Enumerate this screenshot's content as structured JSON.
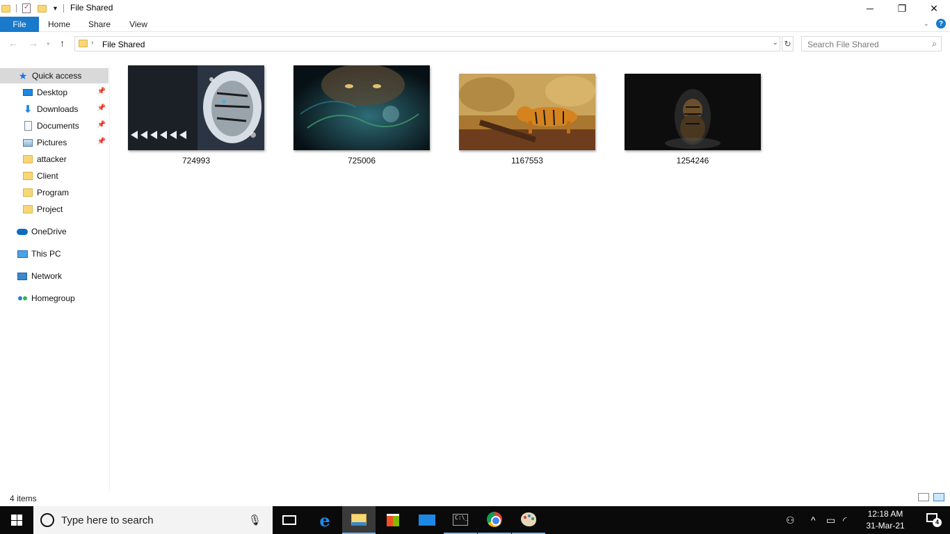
{
  "window": {
    "title": "File Shared"
  },
  "ribbon": {
    "tabs": [
      "File",
      "Home",
      "Share",
      "View"
    ]
  },
  "address": {
    "path": "File Shared"
  },
  "search": {
    "placeholder": "Search File Shared"
  },
  "sidebar": {
    "quick_access": "Quick access",
    "items": [
      {
        "label": "Desktop",
        "icon": "desktop-icon",
        "pinned": true
      },
      {
        "label": "Downloads",
        "icon": "download-icon",
        "pinned": true
      },
      {
        "label": "Documents",
        "icon": "documents-icon",
        "pinned": true
      },
      {
        "label": "Pictures",
        "icon": "pictures-icon",
        "pinned": true
      },
      {
        "label": "attacker",
        "icon": "folder-icon",
        "pinned": false
      },
      {
        "label": "Client",
        "icon": "folder-icon",
        "pinned": false
      },
      {
        "label": "Program",
        "icon": "folder-icon",
        "pinned": false
      },
      {
        "label": "Project",
        "icon": "folder-icon",
        "pinned": false
      }
    ],
    "locations": [
      "OneDrive",
      "This PC",
      "Network",
      "Homegroup"
    ]
  },
  "files": [
    {
      "name": "724993",
      "icon": "tiger-image-thumbnail"
    },
    {
      "name": "725006",
      "icon": "tiger-image-thumbnail"
    },
    {
      "name": "1167553",
      "icon": "tiger-image-thumbnail"
    },
    {
      "name": "1254246",
      "icon": "tiger-image-thumbnail"
    }
  ],
  "status": {
    "item_count": "4 items"
  },
  "taskbar": {
    "search_placeholder": "Type here to search",
    "time": "12:18 AM",
    "date": "31-Mar-21",
    "notification_count": "4"
  },
  "colors": {
    "accent": "#1979ca",
    "folder": "#f8d775",
    "taskbar": "#0a0a0a",
    "selected_nav": "#d9d9d9"
  }
}
